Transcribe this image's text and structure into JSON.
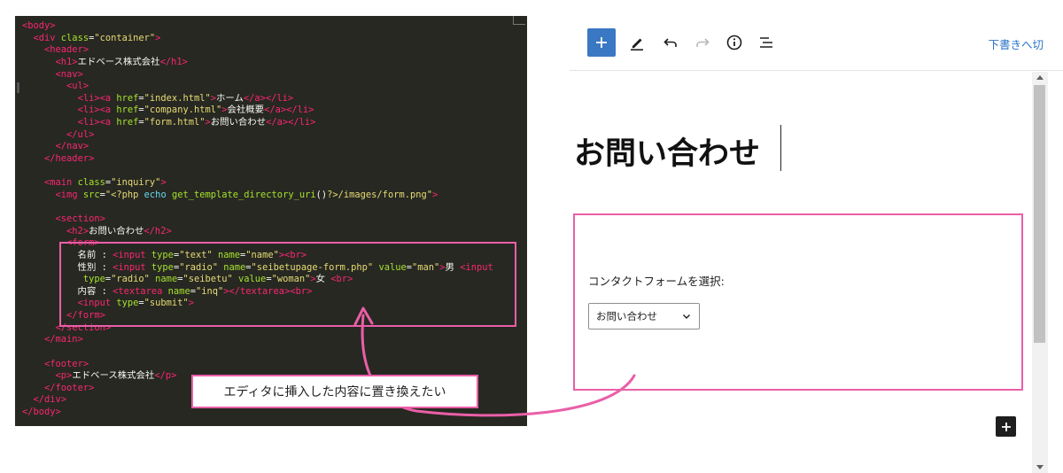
{
  "code_editor": {
    "lines": [
      [
        {
          "t": "tag",
          "v": "<body>"
        }
      ],
      [
        {
          "t": "text",
          "v": "  "
        },
        {
          "t": "tag",
          "v": "<div "
        },
        {
          "t": "attr",
          "v": "class"
        },
        {
          "t": "punct",
          "v": "="
        },
        {
          "t": "str",
          "v": "\"container\""
        },
        {
          "t": "tag",
          "v": ">"
        }
      ],
      [
        {
          "t": "text",
          "v": "    "
        },
        {
          "t": "tag",
          "v": "<header>"
        }
      ],
      [
        {
          "t": "text",
          "v": "      "
        },
        {
          "t": "tag",
          "v": "<h1>"
        },
        {
          "t": "text",
          "v": "エドベース株式会社"
        },
        {
          "t": "tag",
          "v": "</h1>"
        }
      ],
      [
        {
          "t": "text",
          "v": "      "
        },
        {
          "t": "tag",
          "v": "<nav>"
        }
      ],
      [
        {
          "t": "text",
          "v": "        "
        },
        {
          "t": "tag",
          "v": "<ul>"
        }
      ],
      [
        {
          "t": "text",
          "v": "          "
        },
        {
          "t": "tag",
          "v": "<li><a "
        },
        {
          "t": "attr",
          "v": "href"
        },
        {
          "t": "punct",
          "v": "="
        },
        {
          "t": "str",
          "v": "\"index.html\""
        },
        {
          "t": "tag",
          "v": ">"
        },
        {
          "t": "text",
          "v": "ホーム"
        },
        {
          "t": "tag",
          "v": "</a></li>"
        }
      ],
      [
        {
          "t": "text",
          "v": "          "
        },
        {
          "t": "tag",
          "v": "<li><a "
        },
        {
          "t": "attr",
          "v": "href"
        },
        {
          "t": "punct",
          "v": "="
        },
        {
          "t": "str",
          "v": "\"company.html\""
        },
        {
          "t": "tag",
          "v": ">"
        },
        {
          "t": "text",
          "v": "会社概要"
        },
        {
          "t": "tag",
          "v": "</a></li>"
        }
      ],
      [
        {
          "t": "text",
          "v": "          "
        },
        {
          "t": "tag",
          "v": "<li><a "
        },
        {
          "t": "attr",
          "v": "href"
        },
        {
          "t": "punct",
          "v": "="
        },
        {
          "t": "str",
          "v": "\"form.html\""
        },
        {
          "t": "tag",
          "v": ">"
        },
        {
          "t": "text",
          "v": "お問い合わせ"
        },
        {
          "t": "tag",
          "v": "</a></li>"
        }
      ],
      [
        {
          "t": "text",
          "v": "        "
        },
        {
          "t": "tag",
          "v": "</ul>"
        }
      ],
      [
        {
          "t": "text",
          "v": "      "
        },
        {
          "t": "tag",
          "v": "</nav>"
        }
      ],
      [
        {
          "t": "text",
          "v": "    "
        },
        {
          "t": "tag",
          "v": "</header>"
        }
      ],
      [],
      [
        {
          "t": "text",
          "v": "    "
        },
        {
          "t": "tag",
          "v": "<main "
        },
        {
          "t": "attr",
          "v": "class"
        },
        {
          "t": "punct",
          "v": "="
        },
        {
          "t": "str",
          "v": "\"inquiry\""
        },
        {
          "t": "tag",
          "v": ">"
        }
      ],
      [
        {
          "t": "text",
          "v": "      "
        },
        {
          "t": "tag",
          "v": "<img "
        },
        {
          "t": "attr",
          "v": "src"
        },
        {
          "t": "punct",
          "v": "="
        },
        {
          "t": "str",
          "v": "\"<?php "
        },
        {
          "t": "php",
          "v": "echo "
        },
        {
          "t": "attr",
          "v": "get_template_directory_uri"
        },
        {
          "t": "punct",
          "v": "()"
        },
        {
          "t": "str",
          "v": "?>/images/form.png\""
        },
        {
          "t": "tag",
          "v": ">"
        }
      ],
      [],
      [
        {
          "t": "text",
          "v": "      "
        },
        {
          "t": "tag",
          "v": "<section>"
        }
      ],
      [
        {
          "t": "text",
          "v": "        "
        },
        {
          "t": "tag",
          "v": "<h2>"
        },
        {
          "t": "text",
          "v": "お問い合わせ"
        },
        {
          "t": "tag",
          "v": "</h2>"
        }
      ],
      [
        {
          "t": "text",
          "v": "        "
        },
        {
          "t": "tag",
          "v": "<form>"
        }
      ],
      [
        {
          "t": "text",
          "v": "          名前 : "
        },
        {
          "t": "tag",
          "v": "<input "
        },
        {
          "t": "attr",
          "v": "type"
        },
        {
          "t": "punct",
          "v": "="
        },
        {
          "t": "str",
          "v": "\"text\" "
        },
        {
          "t": "attr",
          "v": "name"
        },
        {
          "t": "punct",
          "v": "="
        },
        {
          "t": "str",
          "v": "\"name\""
        },
        {
          "t": "tag",
          "v": "><br>"
        }
      ],
      [
        {
          "t": "text",
          "v": "          性別 : "
        },
        {
          "t": "tag",
          "v": "<input "
        },
        {
          "t": "attr",
          "v": "type"
        },
        {
          "t": "punct",
          "v": "="
        },
        {
          "t": "str",
          "v": "\"radio\" "
        },
        {
          "t": "attr",
          "v": "name"
        },
        {
          "t": "punct",
          "v": "="
        },
        {
          "t": "str",
          "v": "\"seibetupage-form.php\" "
        },
        {
          "t": "attr",
          "v": "value"
        },
        {
          "t": "punct",
          "v": "="
        },
        {
          "t": "str",
          "v": "\"man\""
        },
        {
          "t": "tag",
          "v": ">"
        },
        {
          "t": "text",
          "v": "男 "
        },
        {
          "t": "tag",
          "v": "<input"
        }
      ],
      [
        {
          "t": "text",
          "v": "           "
        },
        {
          "t": "attr",
          "v": "type"
        },
        {
          "t": "punct",
          "v": "="
        },
        {
          "t": "str",
          "v": "\"radio\" "
        },
        {
          "t": "attr",
          "v": "name"
        },
        {
          "t": "punct",
          "v": "="
        },
        {
          "t": "str",
          "v": "\"seibetu\" "
        },
        {
          "t": "attr",
          "v": "value"
        },
        {
          "t": "punct",
          "v": "="
        },
        {
          "t": "str",
          "v": "\"woman\""
        },
        {
          "t": "tag",
          "v": ">"
        },
        {
          "t": "text",
          "v": "女 "
        },
        {
          "t": "tag",
          "v": "<br>"
        }
      ],
      [
        {
          "t": "text",
          "v": "          内容 : "
        },
        {
          "t": "tag",
          "v": "<textarea "
        },
        {
          "t": "attr",
          "v": "name"
        },
        {
          "t": "punct",
          "v": "="
        },
        {
          "t": "str",
          "v": "\"inq\""
        },
        {
          "t": "tag",
          "v": "></textarea><br>"
        }
      ],
      [
        {
          "t": "text",
          "v": "          "
        },
        {
          "t": "tag",
          "v": "<input "
        },
        {
          "t": "attr",
          "v": "type"
        },
        {
          "t": "punct",
          "v": "="
        },
        {
          "t": "str",
          "v": "\"submit\""
        },
        {
          "t": "tag",
          "v": ">"
        }
      ],
      [
        {
          "t": "text",
          "v": "        "
        },
        {
          "t": "tag",
          "v": "</form>"
        }
      ],
      [
        {
          "t": "text",
          "v": "      "
        },
        {
          "t": "tag",
          "v": "</section>"
        }
      ],
      [
        {
          "t": "text",
          "v": "    "
        },
        {
          "t": "tag",
          "v": "</main>"
        }
      ],
      [],
      [
        {
          "t": "text",
          "v": "    "
        },
        {
          "t": "tag",
          "v": "<footer>"
        }
      ],
      [
        {
          "t": "text",
          "v": "      "
        },
        {
          "t": "tag",
          "v": "<p>"
        },
        {
          "t": "text",
          "v": "エドベース株式会社"
        },
        {
          "t": "tag",
          "v": "</p>"
        }
      ],
      [
        {
          "t": "text",
          "v": "    "
        },
        {
          "t": "tag",
          "v": "</footer>"
        }
      ],
      [
        {
          "t": "text",
          "v": "  "
        },
        {
          "t": "tag",
          "v": "</div>"
        }
      ],
      [
        {
          "t": "tag",
          "v": "</body>"
        }
      ]
    ],
    "token_colors": {
      "tag": "#f92672",
      "attr": "#a6e22e",
      "str": "#e6db74",
      "text": "#f8f8f2",
      "php": "#66d9ef",
      "punct": "#f8f8f2"
    }
  },
  "annotation": {
    "callout_text": "エディタに挿入した内容に置き換えたい",
    "accent_color": "#ea5fa8"
  },
  "block_editor": {
    "toolbar": {
      "icons": [
        "plus-icon",
        "pencil-icon",
        "undo-icon",
        "redo-icon",
        "info-icon",
        "list-view-icon"
      ],
      "draft_link": "下書きへ切"
    },
    "post_title": "お問い合わせ",
    "contact_form_block": {
      "label": "コンタクトフォームを選択:",
      "selected_form": "お問い合わせ"
    },
    "colors": {
      "primary": "#3a78c3",
      "link": "#2b74c7"
    }
  }
}
